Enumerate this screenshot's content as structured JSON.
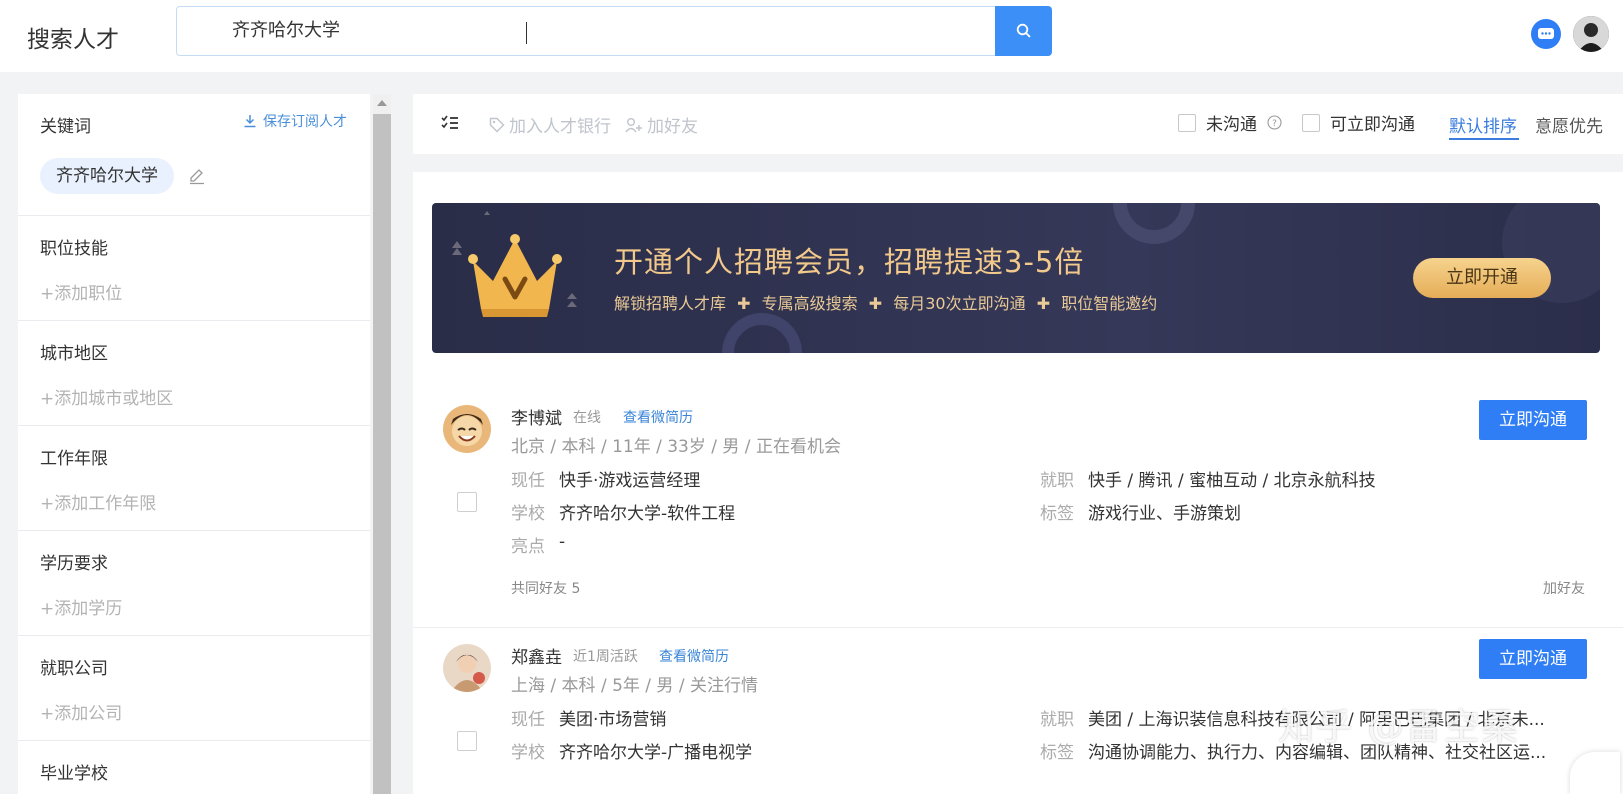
{
  "header": {
    "brand": "搜索人才",
    "search_value": "齐齐哈尔大学"
  },
  "sidebar": {
    "keyword_title": "关键词",
    "save_subscription": "保存订阅人才",
    "keyword_tag": "齐齐哈尔大学",
    "sections": [
      {
        "title": "职位技能",
        "add": "+添加职位"
      },
      {
        "title": "城市地区",
        "add": "+添加城市或地区"
      },
      {
        "title": "工作年限",
        "add": "+添加工作年限"
      },
      {
        "title": "学历要求",
        "add": "+添加学历"
      },
      {
        "title": "就职公司",
        "add": "+添加公司"
      },
      {
        "title": "毕业学校"
      }
    ]
  },
  "toolbar": {
    "add_to_bank": "加入人才银行",
    "add_friend": "加好友",
    "filter_uncontacted": "未沟通",
    "filter_instant": "可立即沟通",
    "sort_default": "默认排序",
    "sort_intent": "意愿优先"
  },
  "banner": {
    "title": "开通个人招聘会员，招聘提速3-5倍",
    "features": [
      "解锁招聘人才库",
      "专属高级搜索",
      "每月30次立即沟通",
      "职位智能邀约"
    ],
    "button": "立即开通"
  },
  "candidates": [
    {
      "name": "李博斌",
      "status": "在线",
      "resume_link": "查看微简历",
      "meta": "北京 / 本科 / 11年 / 33岁 / 男 / 正在看机会",
      "current_label": "现任",
      "current": "快手·游戏运营经理",
      "jobs_label": "就职",
      "jobs": "快手 / 腾讯 / 蜜柚互动 / 北京永航科技",
      "school_label": "学校",
      "school": "齐齐哈尔大学-软件工程",
      "tags_label": "标签",
      "tags": "游戏行业、手游策划",
      "highlight_label": "亮点",
      "highlight": "-",
      "mutual_friends": "共同好友 5",
      "add_friend": "加好友",
      "talk_button": "立即沟通"
    },
    {
      "name": "郑鑫垚",
      "status": "近1周活跃",
      "resume_link": "查看微简历",
      "meta": "上海 / 本科 / 5年 / 男 / 关注行情",
      "current_label": "现任",
      "current": "美团·市场营销",
      "jobs_label": "就职",
      "jobs": "美团 / 上海识装信息科技有限公司 / 阿里巴巴集团 / 北京未...",
      "school_label": "学校",
      "school": "齐齐哈尔大学-广播电视学",
      "tags_label": "标签",
      "tags": "沟通协调能力、执行力、内容编辑、团队精神、社交社区运...",
      "talk_button": "立即沟通"
    }
  ],
  "watermark": "知乎 @雷空桑",
  "colors": {
    "primary": "#2f7ef5",
    "link": "#3a85d8",
    "banner_gold": "#f2c98a",
    "banner_bg": "#2a2d48"
  }
}
